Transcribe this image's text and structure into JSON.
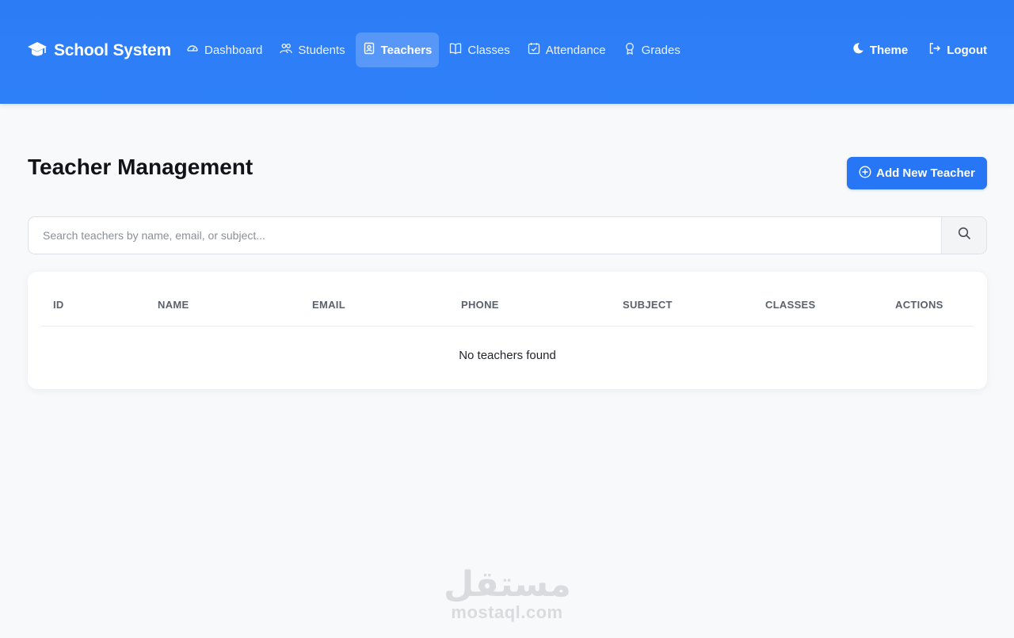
{
  "app": {
    "title": "School System"
  },
  "nav": {
    "items": [
      {
        "label": "Dashboard",
        "icon": "gauge-icon",
        "active": false
      },
      {
        "label": "Students",
        "icon": "users-icon",
        "active": false
      },
      {
        "label": "Teachers",
        "icon": "teacher-badge-icon",
        "active": true
      },
      {
        "label": "Classes",
        "icon": "book-icon",
        "active": false
      },
      {
        "label": "Attendance",
        "icon": "calendar-check-icon",
        "active": false
      },
      {
        "label": "Grades",
        "icon": "award-icon",
        "active": false
      }
    ],
    "theme_label": "Theme",
    "logout_label": "Logout"
  },
  "page": {
    "title": "Teacher Management",
    "add_button_label": "Add New Teacher"
  },
  "search": {
    "placeholder": "Search teachers by name, email, or subject..."
  },
  "table": {
    "columns": [
      "ID",
      "NAME",
      "EMAIL",
      "PHONE",
      "SUBJECT",
      "CLASSES",
      "ACTIONS"
    ],
    "empty_message": "No teachers found"
  },
  "watermark": {
    "arabic": "مستقل",
    "latin": "mostaql.com"
  },
  "colors": {
    "primary": "#2d7ff9",
    "button": "#2676f5",
    "background": "#f8f9fb"
  }
}
